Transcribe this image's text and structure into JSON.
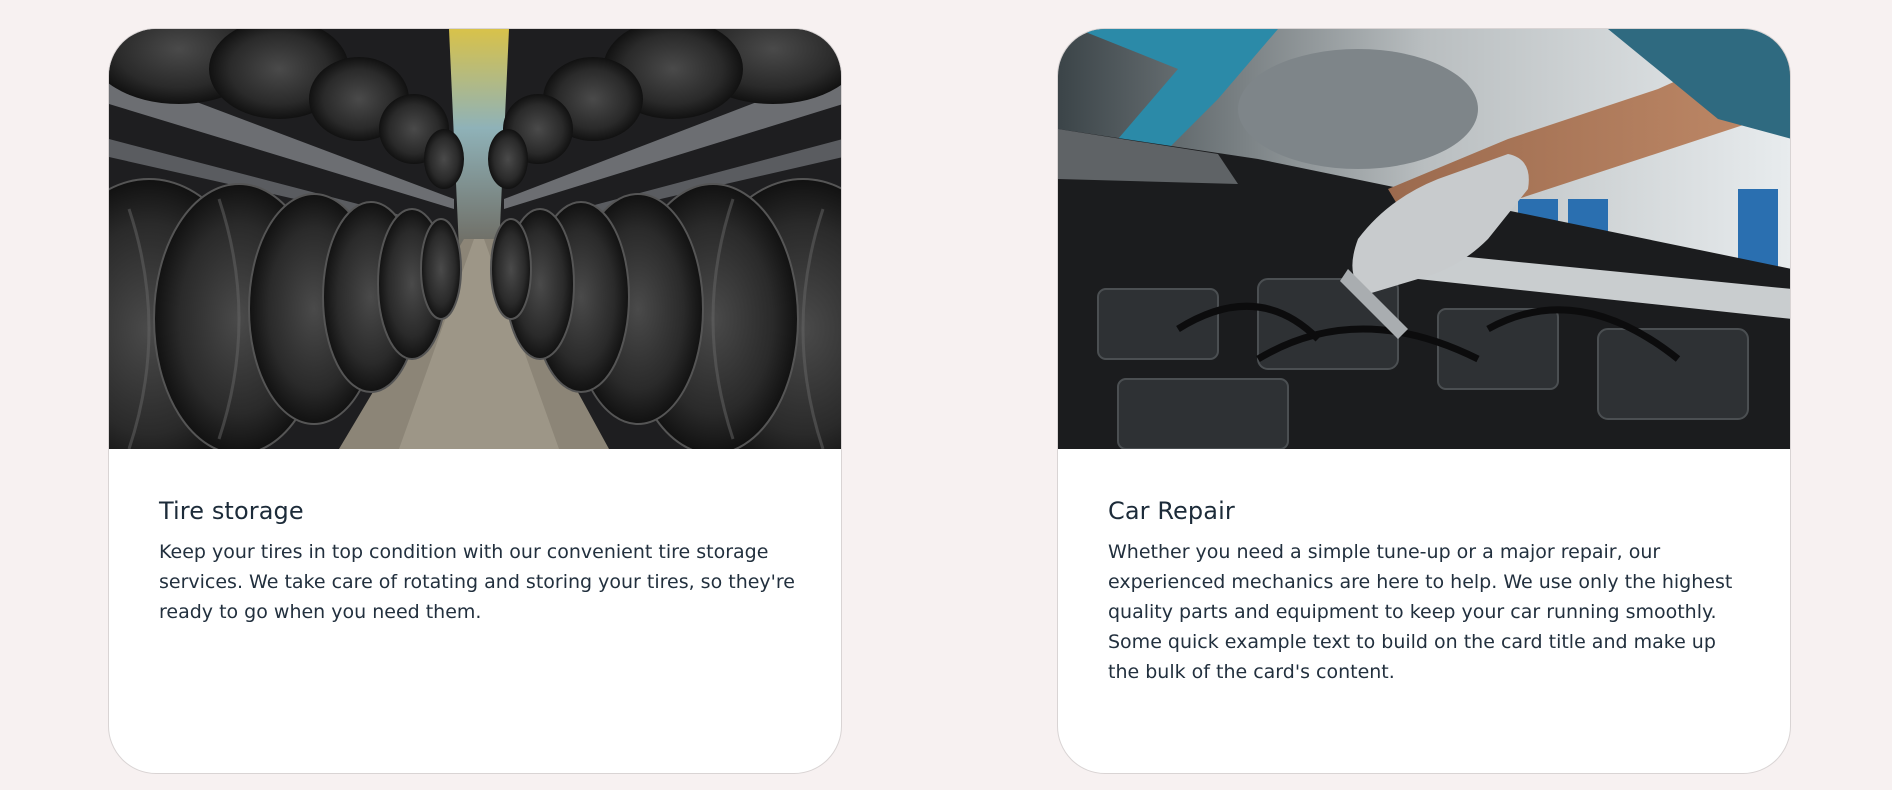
{
  "cards": [
    {
      "title": "Tire storage",
      "text": "Keep your tires in top condition with our convenient tire storage services. We take care of rotating and storing your tires, so they're ready to go when you need them.",
      "image": "tire-warehouse-photo"
    },
    {
      "title": "Car Repair",
      "text": "Whether you need a simple tune-up or a major repair, our experienced mechanics are here to help. We use only the highest quality parts and equipment to keep your car running smoothly. Some quick example text to build on the card title and make up the bulk of the card's content.",
      "image": "mechanic-engine-photo"
    }
  ],
  "colors": {
    "page_background": "#f7f1f1",
    "card_background": "#ffffff",
    "card_border": "#d9d4d4",
    "text": "#1c2b39"
  }
}
